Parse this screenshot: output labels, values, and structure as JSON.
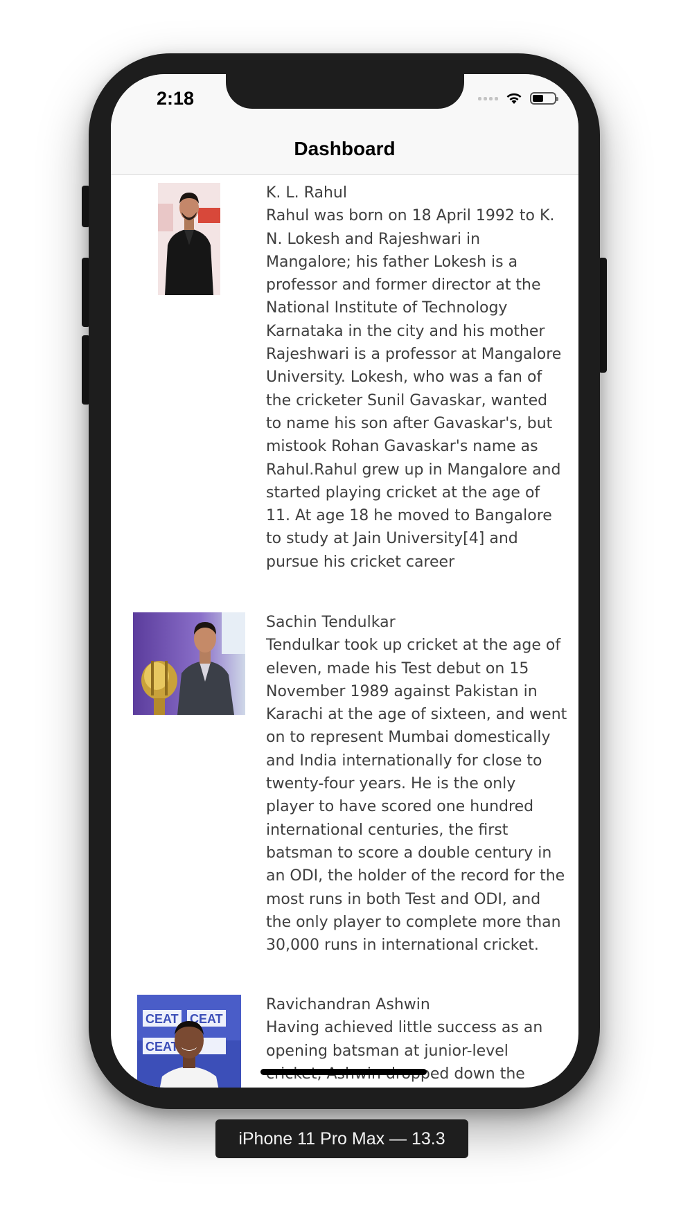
{
  "status_bar": {
    "time": "2:18"
  },
  "nav": {
    "title": "Dashboard"
  },
  "players": [
    {
      "name": "K. L. Rahul",
      "description": "Rahul was born on 18 April 1992 to K. N. Lokesh and Rajeshwari in Mangalore; his father Lokesh is a professor and former director at the National Institute of Technology Karnataka in the city and his mother Rajeshwari is a professor at Mangalore University. Lokesh, who was a fan of the cricketer Sunil Gavaskar, wanted to name his son after Gavaskar's, but mistook Rohan Gavaskar's name as Rahul.Rahul grew up in Mangalore and started playing cricket at the age of 11. At age 18 he moved to Bangalore to study at Jain University[4] and pursue his cricket career"
    },
    {
      "name": "Sachin Tendulkar",
      "description": "Tendulkar took up cricket at the age of eleven, made his Test debut on 15 November 1989 against Pakistan in Karachi at the age of sixteen, and went on to represent Mumbai domestically and India internationally for close to twenty-four years. He is the only player to have scored one hundred international centuries, the first batsman to score a double century in an ODI, the holder of the record for the most runs in both Test and ODI, and the only player to complete more than 30,000 runs in international cricket."
    },
    {
      "name": "Ravichandran Ashwin",
      "description": "Having achieved little success as an opening batsman at junior-level cricket, Ashwin dropped down the order and"
    }
  ],
  "photo_texts": {
    "ceat": "CEAT"
  },
  "device_label": "iPhone 11 Pro Max — 13.3"
}
